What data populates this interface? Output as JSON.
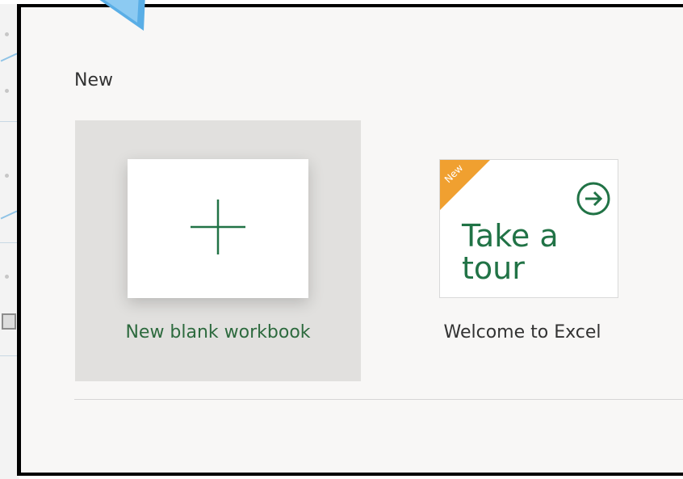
{
  "section": {
    "title": "New"
  },
  "templates": [
    {
      "label": "New blank workbook",
      "selected": true
    },
    {
      "label": "Welcome to Excel",
      "ribbon": "New",
      "thumbnail_text": "Take a\ntour",
      "selected": false
    }
  ],
  "colors": {
    "excel_green": "#217346",
    "ribbon_orange": "#f0a030",
    "selected_tile_bg": "#e1e0de",
    "panel_bg": "#f8f7f6",
    "pointer_blue": "#5aaee6"
  },
  "icons": {
    "blank_thumbnail": "plus-icon",
    "tour_thumbnail": "arrow-circle-right-icon",
    "pointer": "callout-arrow-icon"
  }
}
